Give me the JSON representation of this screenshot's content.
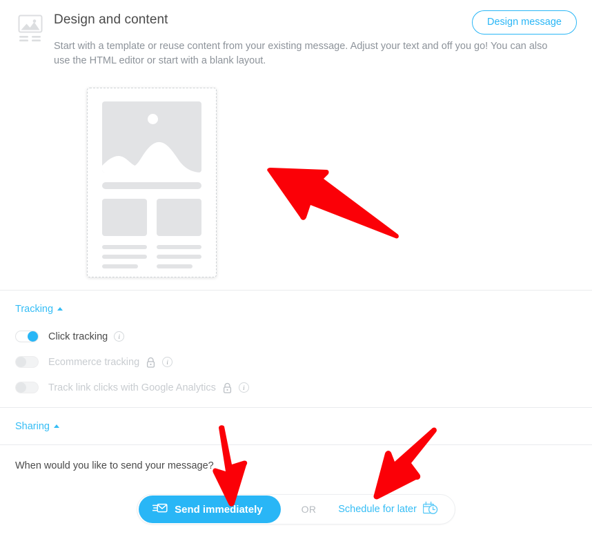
{
  "design": {
    "icon": "image-layout-icon",
    "title": "Design and content",
    "description": "Start with a template or reuse content from your existing message. Adjust your text and off you go! You can also use the HTML editor or start with a blank layout.",
    "action_button": "Design message",
    "template_card_name": "email-template-preview"
  },
  "tracking": {
    "section_label": "Tracking",
    "collapse_state": "expanded",
    "options": [
      {
        "label": "Click tracking",
        "enabled": true,
        "locked": false,
        "has_info": true
      },
      {
        "label": "Ecommerce tracking",
        "enabled": false,
        "locked": true,
        "has_info": true
      },
      {
        "label": "Track link clicks with Google Analytics",
        "enabled": false,
        "locked": true,
        "has_info": true
      }
    ]
  },
  "sharing": {
    "section_label": "Sharing",
    "collapse_state": "expanded"
  },
  "schedule": {
    "question": "When would you like to send your message?",
    "send_now_label": "Send immediately",
    "send_now_icon": "envelope-send-icon",
    "or_label": "OR",
    "schedule_label": "Schedule for later",
    "schedule_icon": "calendar-clock-icon",
    "selected": "Send immediately"
  },
  "annotations": {
    "arrows": [
      {
        "name": "arrow-pointing-to-template",
        "direction": "up-left"
      },
      {
        "name": "arrow-pointing-to-send-immediately",
        "direction": "down"
      },
      {
        "name": "arrow-pointing-to-schedule-for-later",
        "direction": "down-left"
      }
    ],
    "color": "#fb0007"
  },
  "colors": {
    "accent": "#29b6f6",
    "link": "#35bdf5",
    "text": "#4a4a4a",
    "muted": "#8d939a",
    "disabled": "#c8ccd0",
    "placeholder_grey": "#e2e3e5",
    "annotation_red": "#fb0007"
  }
}
